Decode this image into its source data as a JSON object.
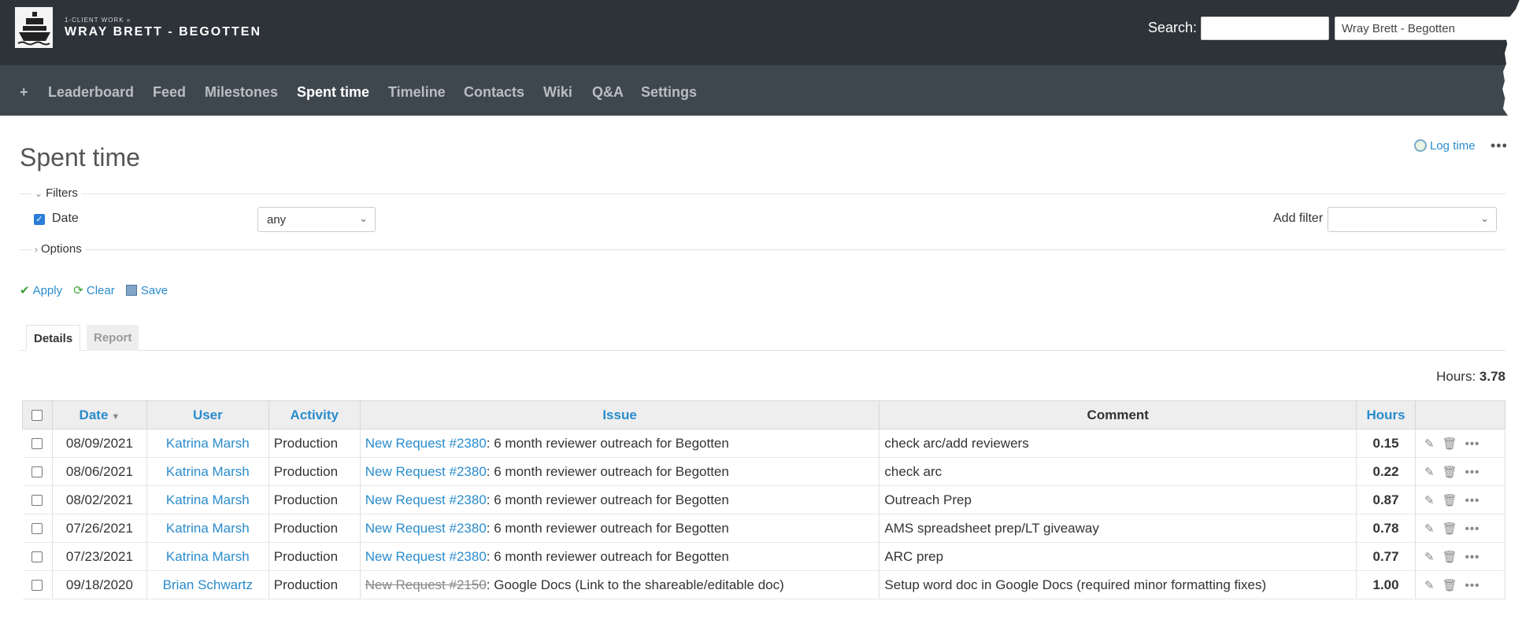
{
  "header": {
    "breadcrumb": "1-Client Work »",
    "project": "WRAY BRETT - BEGOTTEN",
    "search_label": "Search:",
    "search_value": "",
    "jump_value": "Wray Brett - Begotten"
  },
  "nav": {
    "plus": "+",
    "items": [
      "Leaderboard",
      "Feed",
      "Milestones",
      "Spent time",
      "Timeline",
      "Contacts",
      "Wiki",
      "Q&A",
      "Settings"
    ],
    "active": "Spent time"
  },
  "page": {
    "title": "Spent time",
    "log_time": "Log time",
    "more": "•••"
  },
  "filters": {
    "legend": "Filters",
    "date_label": "Date",
    "date_operator": "any",
    "add_filter_label": "Add filter",
    "options_legend": "Options"
  },
  "actions": {
    "apply": "Apply",
    "clear": "Clear",
    "save": "Save"
  },
  "tabs": {
    "details": "Details",
    "report": "Report"
  },
  "total": {
    "label": "Hours:",
    "value": "3.78"
  },
  "table": {
    "headers": {
      "date": "Date",
      "user": "User",
      "activity": "Activity",
      "issue": "Issue",
      "comment": "Comment",
      "hours": "Hours"
    },
    "rows": [
      {
        "date": "08/09/2021",
        "user": "Katrina Marsh",
        "activity": "Production",
        "issue_link": "New Request #2380",
        "issue_rest": ": 6 month reviewer outreach for Begotten",
        "comment": "check arc/add reviewers",
        "hours": "0.15",
        "closed": false
      },
      {
        "date": "08/06/2021",
        "user": "Katrina Marsh",
        "activity": "Production",
        "issue_link": "New Request #2380",
        "issue_rest": ": 6 month reviewer outreach for Begotten",
        "comment": "check arc",
        "hours": "0.22",
        "closed": false
      },
      {
        "date": "08/02/2021",
        "user": "Katrina Marsh",
        "activity": "Production",
        "issue_link": "New Request #2380",
        "issue_rest": ": 6 month reviewer outreach for Begotten",
        "comment": "Outreach Prep",
        "hours": "0.87",
        "closed": false
      },
      {
        "date": "07/26/2021",
        "user": "Katrina Marsh",
        "activity": "Production",
        "issue_link": "New Request #2380",
        "issue_rest": ": 6 month reviewer outreach for Begotten",
        "comment": "AMS spreadsheet prep/LT giveaway",
        "hours": "0.78",
        "closed": false
      },
      {
        "date": "07/23/2021",
        "user": "Katrina Marsh",
        "activity": "Production",
        "issue_link": "New Request #2380",
        "issue_rest": ": 6 month reviewer outreach for Begotten",
        "comment": "ARC prep",
        "hours": "0.77",
        "closed": false
      },
      {
        "date": "09/18/2020",
        "user": "Brian Schwartz",
        "activity": "Production",
        "issue_link": "New Request #2150",
        "issue_rest": ": Google Docs (Link to the shareable/editable doc)",
        "comment": "Setup word doc in Google Docs (required minor formatting fixes)",
        "hours": "1.00",
        "closed": true
      }
    ]
  }
}
